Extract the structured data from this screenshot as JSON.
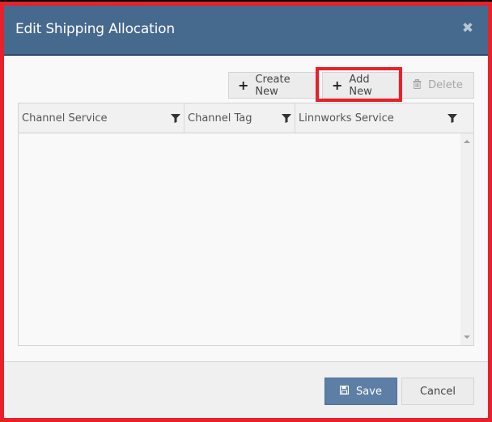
{
  "dialog": {
    "title": "Edit Shipping Allocation",
    "close_icon": "close-icon"
  },
  "toolbar": {
    "create_new_label": "Create New",
    "add_new_label": "Add New",
    "delete_label": "Delete",
    "plus_glyph": "+",
    "trash_glyph": "🗑"
  },
  "grid": {
    "columns": [
      {
        "label": "Channel Service"
      },
      {
        "label": "Channel Tag"
      },
      {
        "label": "Linnworks Service"
      }
    ],
    "rows": []
  },
  "footer": {
    "save_label": "Save",
    "cancel_label": "Cancel",
    "save_glyph": "🖫"
  },
  "colors": {
    "header_bg": "#46698e",
    "highlight": "#e8202a",
    "save_bg": "#5d7fa6"
  }
}
